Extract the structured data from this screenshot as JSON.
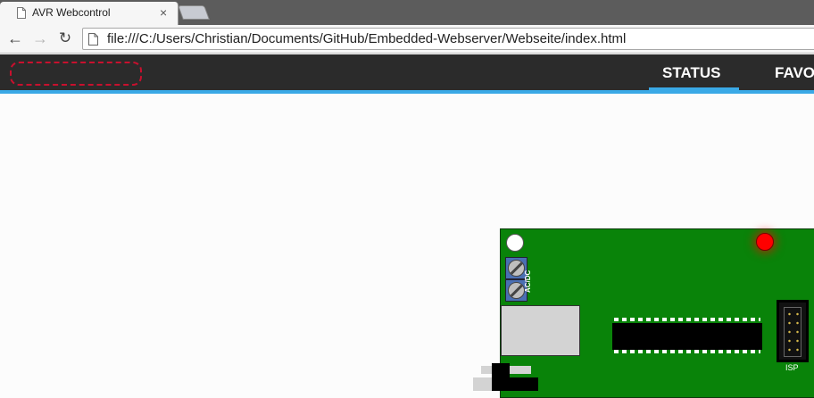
{
  "browser": {
    "tab_title": "AVR Webcontrol",
    "tab_close": "×",
    "url": "file:///C:/Users/Christian/Documents/GitHub/Embedded-Webserver/Webseite/index.html",
    "back_glyph": "←",
    "forward_glyph": "→",
    "reload_glyph": "↻"
  },
  "site": {
    "nav": [
      {
        "label": "STATUS",
        "active": true
      },
      {
        "label": "FAVO",
        "active": false
      }
    ],
    "accent_color": "#3aa9e6",
    "header_color": "#2b2b2b"
  },
  "board": {
    "board_color": "#098309",
    "led_color": "#ff0000",
    "power_label": "AC/DC",
    "isp_label": "ISP"
  }
}
